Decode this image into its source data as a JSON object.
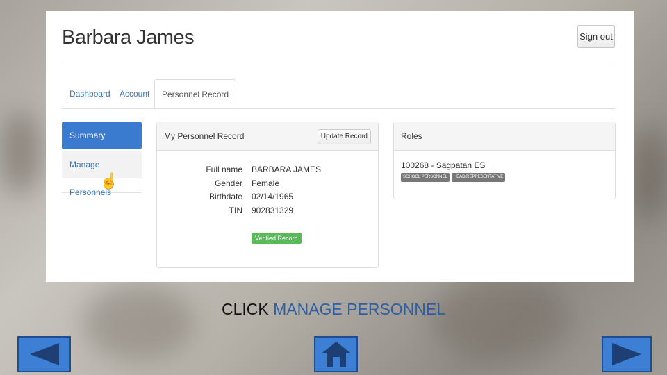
{
  "header": {
    "user_name": "Barbara James",
    "signout_label": "Sign out"
  },
  "tabs": [
    {
      "label": "Dashboard"
    },
    {
      "label": "Account"
    },
    {
      "label": "Personnel Record",
      "active": true
    }
  ],
  "sidebar": {
    "items": [
      {
        "label": "Summary",
        "active": true
      },
      {
        "label": "Manage Personnels",
        "active": false
      }
    ]
  },
  "record_panel": {
    "title": "My Personnel Record",
    "update_label": "Update Record",
    "rows": [
      {
        "label": "Full name",
        "value": "BARBARA JAMES"
      },
      {
        "label": "Gender",
        "value": "Female"
      },
      {
        "label": "Birthdate",
        "value": "02/14/1965"
      },
      {
        "label": "TIN",
        "value": "902831329"
      }
    ],
    "verified_label": "Verified Record"
  },
  "roles_panel": {
    "title": "Roles",
    "role": "100268 - Sagpatan ES",
    "badges": [
      "SCHOOL PERSONNEL",
      "HEAD/REPRESENTATIVE"
    ]
  },
  "caption": {
    "prefix": "CLICK",
    "highlight": "MANAGE PERSONNEL"
  },
  "nav": {
    "accent": "#3c7fd4"
  }
}
